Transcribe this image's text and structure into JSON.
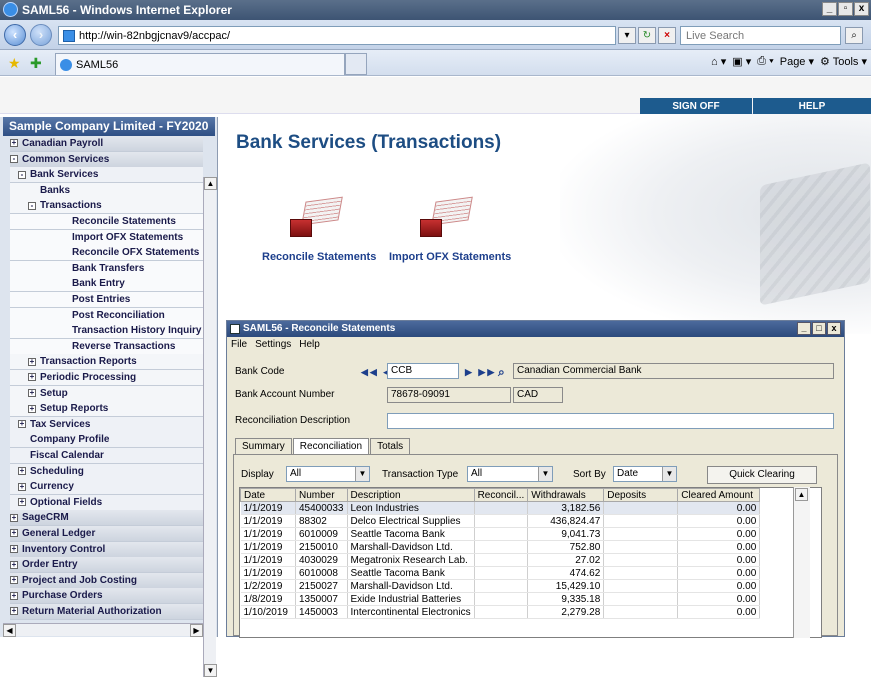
{
  "browser": {
    "title": "SAML56 - Windows Internet Explorer",
    "url": "http://win-82nbgjcnav9/accpac/",
    "search_placeholder": "Live Search",
    "tab_title": "SAML56",
    "tools": {
      "page": "Page",
      "tools": "Tools"
    }
  },
  "header": {
    "sign_off": "SIGN OFF",
    "help": "HELP"
  },
  "sidebar": {
    "company": "Sample Company Limited - FY2020",
    "items": [
      {
        "label": "Canadian Payroll",
        "level": 0,
        "exp": "+"
      },
      {
        "label": "Common Services",
        "level": 0,
        "exp": "-"
      },
      {
        "label": "Bank Services",
        "level": 1,
        "exp": "-"
      },
      {
        "label": "Banks",
        "level": 2,
        "exp": ""
      },
      {
        "label": "Transactions",
        "level": 2,
        "exp": "-"
      },
      {
        "label": "Reconcile Statements",
        "level": 3,
        "exp": ""
      },
      {
        "label": "Import OFX Statements",
        "level": 3,
        "exp": ""
      },
      {
        "label": "Reconcile OFX Statements",
        "level": 3,
        "exp": ""
      },
      {
        "label": "Bank Transfers",
        "level": 3,
        "exp": ""
      },
      {
        "label": "Bank Entry",
        "level": 3,
        "exp": ""
      },
      {
        "label": "Post Entries",
        "level": 3,
        "exp": ""
      },
      {
        "label": "Post Reconciliation",
        "level": 3,
        "exp": ""
      },
      {
        "label": "Transaction History Inquiry",
        "level": 3,
        "exp": ""
      },
      {
        "label": "Reverse Transactions",
        "level": 3,
        "exp": ""
      },
      {
        "label": "Transaction Reports",
        "level": 2,
        "exp": "+"
      },
      {
        "label": "Periodic Processing",
        "level": 2,
        "exp": "+"
      },
      {
        "label": "Setup",
        "level": 2,
        "exp": "+"
      },
      {
        "label": "Setup Reports",
        "level": 2,
        "exp": "+"
      },
      {
        "label": "Tax Services",
        "level": 1,
        "exp": "+"
      },
      {
        "label": "Company Profile",
        "level": 1,
        "exp": ""
      },
      {
        "label": "Fiscal Calendar",
        "level": 1,
        "exp": ""
      },
      {
        "label": "Scheduling",
        "level": 1,
        "exp": "+"
      },
      {
        "label": "Currency",
        "level": 1,
        "exp": "+"
      },
      {
        "label": "Optional Fields",
        "level": 1,
        "exp": "+"
      },
      {
        "label": "SageCRM",
        "level": 0,
        "exp": "+"
      },
      {
        "label": "General Ledger",
        "level": 0,
        "exp": "+"
      },
      {
        "label": "Inventory Control",
        "level": 0,
        "exp": "+"
      },
      {
        "label": "Order Entry",
        "level": 0,
        "exp": "+"
      },
      {
        "label": "Project and Job Costing",
        "level": 0,
        "exp": "+"
      },
      {
        "label": "Purchase Orders",
        "level": 0,
        "exp": "+"
      },
      {
        "label": "Return Material Authorization",
        "level": 0,
        "exp": "+"
      }
    ]
  },
  "main": {
    "title": "Bank Services (Transactions)",
    "links": [
      "Reconcile Statements",
      "Import OFX Statements"
    ]
  },
  "window": {
    "title": "SAML56 - Reconcile Statements",
    "menu": [
      "File",
      "Settings",
      "Help"
    ],
    "bank_code_label": "Bank Code",
    "bank_code": "CCB",
    "bank_name": "Canadian Commercial Bank",
    "account_label": "Bank Account Number",
    "account_number": "78678-09091",
    "currency": "CAD",
    "desc_label": "Reconciliation Description",
    "tabs": [
      "Summary",
      "Reconciliation",
      "Totals"
    ],
    "display_label": "Display",
    "display_value": "All",
    "type_label": "Transaction Type",
    "type_value": "All",
    "sort_label": "Sort By",
    "sort_value": "Date",
    "quick_clearing": "Quick Clearing",
    "columns": [
      "Date",
      "Number",
      "Description",
      "Reconcil...",
      "Withdrawals",
      "Deposits",
      "Cleared Amount"
    ],
    "rows": [
      [
        "1/1/2019",
        "45400033",
        "Leon Industries",
        "",
        "3,182.56",
        "",
        "0.00"
      ],
      [
        "1/1/2019",
        "88302",
        "Delco Electrical Supplies",
        "",
        "436,824.47",
        "",
        "0.00"
      ],
      [
        "1/1/2019",
        "6010009",
        "Seattle Tacoma Bank",
        "",
        "9,041.73",
        "",
        "0.00"
      ],
      [
        "1/1/2019",
        "2150010",
        "Marshall-Davidson Ltd.",
        "",
        "752.80",
        "",
        "0.00"
      ],
      [
        "1/1/2019",
        "4030029",
        "Megatronix Research Lab.",
        "",
        "27.02",
        "",
        "0.00"
      ],
      [
        "1/1/2019",
        "6010008",
        "Seattle Tacoma Bank",
        "",
        "474.62",
        "",
        "0.00"
      ],
      [
        "1/2/2019",
        "2150027",
        "Marshall-Davidson Ltd.",
        "",
        "15,429.10",
        "",
        "0.00"
      ],
      [
        "1/8/2019",
        "1350007",
        "Exide Industrial Batteries",
        "",
        "9,335.18",
        "",
        "0.00"
      ],
      [
        "1/10/2019",
        "1450003",
        "Intercontinental Electronics",
        "",
        "2,279.28",
        "",
        "0.00"
      ]
    ]
  }
}
